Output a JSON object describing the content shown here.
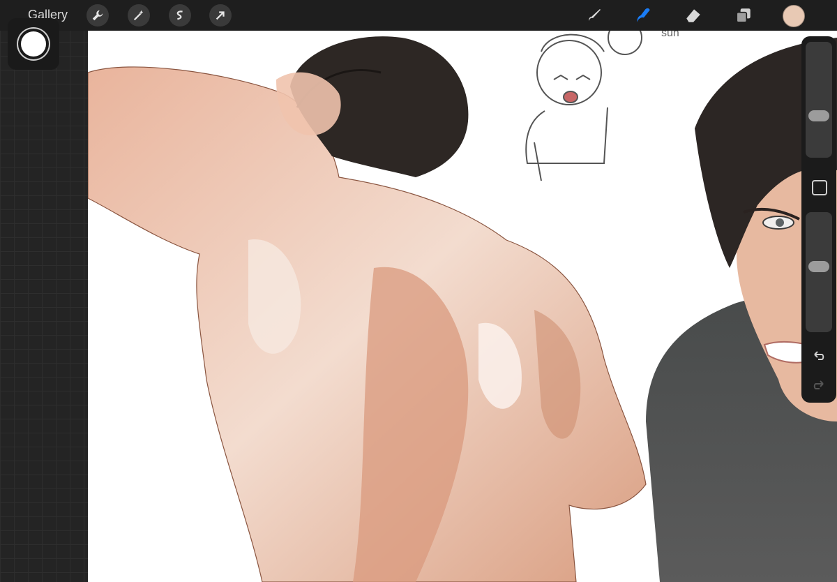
{
  "topbar": {
    "gallery_label": "Gallery",
    "left_tools": [
      {
        "name": "actions-wrench-icon"
      },
      {
        "name": "adjustments-magic-icon"
      },
      {
        "name": "selection-icon"
      },
      {
        "name": "transform-arrow-icon"
      }
    ],
    "right_tools": [
      {
        "name": "brush-icon"
      },
      {
        "name": "smudge-icon",
        "active": true
      },
      {
        "name": "eraser-icon"
      },
      {
        "name": "layers-icon"
      }
    ],
    "active_color": "#e8c9b4"
  },
  "canvas": {
    "sketch_note": "sun"
  },
  "sidebar": {
    "brush_size_level": 0.35,
    "opacity_level": 0.55
  },
  "colors": {
    "accent_blue": "#1a7cf5",
    "ui_bg": "#1e1e1e"
  }
}
